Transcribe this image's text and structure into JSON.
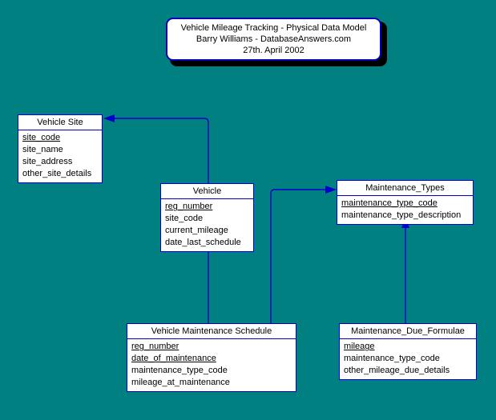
{
  "background_color": "#008080",
  "accent_color": "#0000cc",
  "title_card": {
    "line1": "Vehicle Mileage Tracking - Physical Data Model",
    "line2": "Barry Williams - DatabaseAnswers.com",
    "line3": "27th. April 2002"
  },
  "entities": {
    "vehicle_site": {
      "name": "Vehicle Site",
      "attributes": [
        {
          "label": "site_code",
          "primary_key": true
        },
        {
          "label": "site_name",
          "primary_key": false
        },
        {
          "label": "site_address",
          "primary_key": false
        },
        {
          "label": "other_site_details",
          "primary_key": false
        }
      ]
    },
    "vehicle": {
      "name": "Vehicle",
      "attributes": [
        {
          "label": "reg_number",
          "primary_key": true
        },
        {
          "label": "site_code",
          "primary_key": false
        },
        {
          "label": "current_mileage",
          "primary_key": false
        },
        {
          "label": "date_last_schedule",
          "primary_key": false
        }
      ]
    },
    "maintenance_types": {
      "name": "Maintenance_Types",
      "attributes": [
        {
          "label": "maintenance_type_code",
          "primary_key": true
        },
        {
          "label": "maintenance_type_description",
          "primary_key": false
        }
      ]
    },
    "vehicle_maintenance_schedule": {
      "name": "Vehicle Maintenance Schedule",
      "attributes": [
        {
          "label": "reg_number",
          "primary_key": true
        },
        {
          "label": "date_of_maintenance",
          "primary_key": true
        },
        {
          "label": "maintenance_type_code",
          "primary_key": false
        },
        {
          "label": "mileage_at_maintenance",
          "primary_key": false
        }
      ]
    },
    "maintenance_due_formulae": {
      "name": "Maintenance_Due_Formulae",
      "attributes": [
        {
          "label": "mileage",
          "primary_key": true
        },
        {
          "label": "maintenance_type_code",
          "primary_key": false
        },
        {
          "label": "other_mileage_due_details",
          "primary_key": false
        }
      ]
    }
  },
  "relationships": [
    {
      "from": "vehicle",
      "to": "vehicle_site",
      "arrow": "left"
    },
    {
      "from": "vehicle_maintenance_schedule",
      "to": "vehicle",
      "arrow": "up"
    },
    {
      "from": "vehicle_maintenance_schedule",
      "to": "maintenance_types",
      "arrow": "right"
    },
    {
      "from": "maintenance_due_formulae",
      "to": "maintenance_types",
      "arrow": "up"
    }
  ]
}
